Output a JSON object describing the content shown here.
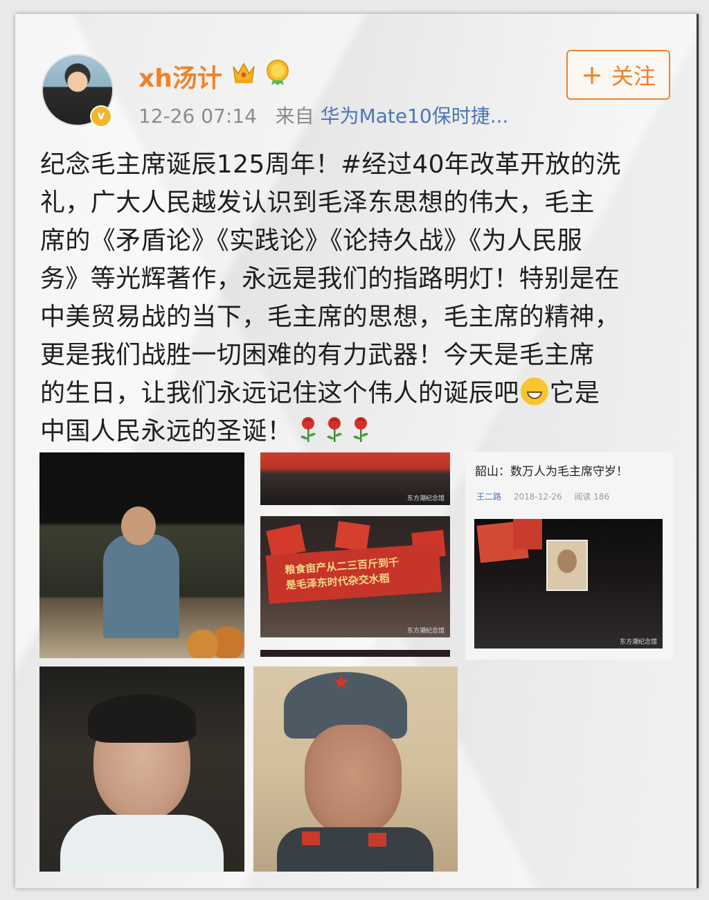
{
  "post": {
    "username": "xh汤计",
    "timestamp": "12-26 07:14",
    "source_prefix": "来自",
    "device": "华为Mate10保时捷...",
    "follow_label": "关注",
    "follow_plus": "+",
    "verified_badge": "v",
    "text_lines": [
      "纪念毛主席诞辰125周年！#经过40年改革开放的洗",
      "礼，广大人民越发认识到毛泽东思想的伟大，毛主",
      "席的《矛盾论》《实践论》《论持久战》《为人民服",
      "务》等光辉著作，永远是我们的指路明灯！特别是在",
      "中美贸易战的当下，毛主席的思想，毛主席的精神，",
      "更是我们战胜一切困难的有力武器！今天是毛主席",
      "的生日，让我们永远记住这个伟人的诞辰吧",
      "它是",
      "中国人民永远的圣诞！"
    ],
    "icons": [
      "crown-icon",
      "medal-icon",
      "laugh-emoji-icon",
      "rose-icon"
    ]
  },
  "article": {
    "title": "韶山：数万人为毛主席守岁！",
    "author": "王二路",
    "date": "2018-12-26",
    "reads_label": "阅读",
    "reads": "186"
  },
  "photos": {
    "banner_text_1": "粮食亩产从二三百斤到千",
    "banner_text_2": "是毛泽东时代杂交水稻",
    "watermark": "东方潮纪念馆"
  },
  "colors": {
    "accent": "#f0822a",
    "link": "#4b76b7",
    "meta_gray": "#8b8b8b",
    "text": "#1e1e1e",
    "rose": "#d4302a"
  }
}
